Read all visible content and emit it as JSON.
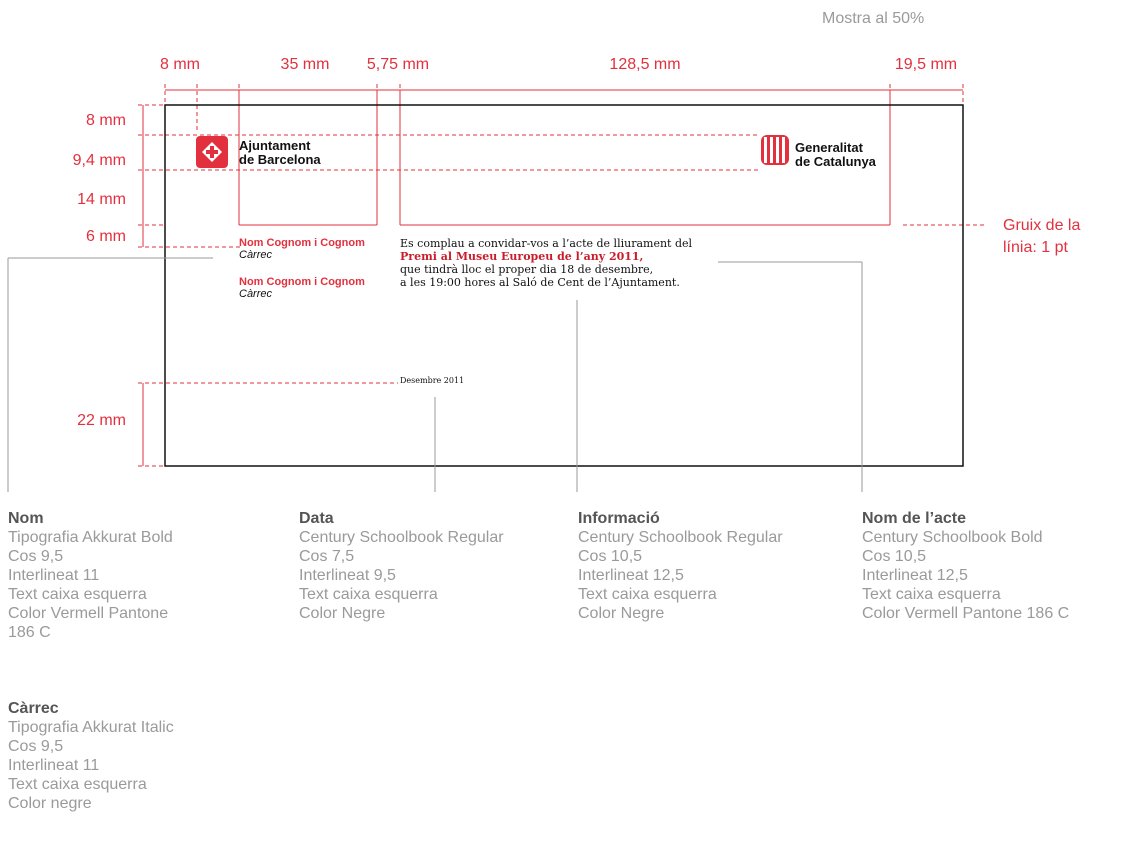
{
  "header": {
    "sample_scale": "Mostra al 50%"
  },
  "horizontal_measures": [
    "8 mm",
    "35 mm",
    "5,75 mm",
    "128,5 mm",
    "19,5 mm"
  ],
  "vertical_measures": [
    "8 mm",
    "9,4 mm",
    "14 mm",
    "6 mm",
    "22 mm"
  ],
  "line_note": {
    "line1": "Gruix de la",
    "line2": "línia: 1 pt"
  },
  "card": {
    "logo_left": {
      "line1": "Ajuntament",
      "line2": "de Barcelona"
    },
    "logo_right": {
      "line1": "Generalitat",
      "line2": "de Catalunya"
    },
    "signers": [
      {
        "name": "Nom Cognom i Cognom",
        "role": "Càrrec"
      },
      {
        "name": "Nom Cognom i Cognom",
        "role": "Càrrec"
      }
    ],
    "info_lines": [
      "Es complau a convidar-vos a l’acte de lliurament del",
      "Premi al Museu Europeu de l’any 2011,",
      "que tindrà lloc el proper dia 18 de desembre,",
      "a les 19:00 hores al Saló de Cent de l’Ajuntament."
    ],
    "date": "Desembre 2011"
  },
  "specs": {
    "nom": {
      "title": "Nom",
      "lines": [
        "Tipografia Akkurat Bold",
        "Cos 9,5",
        "Interlineat 11",
        "Text caixa esquerra",
        "Color Vermell Pantone",
        "186 C"
      ]
    },
    "carrec": {
      "title": "Càrrec",
      "lines": [
        "Tipografia Akkurat Italic",
        "Cos 9,5",
        "Interlineat 11",
        "Text caixa esquerra",
        "Color negre"
      ]
    },
    "data": {
      "title": "Data",
      "lines": [
        "Century Schoolbook Regular",
        "Cos 7,5",
        "Interlineat 9,5",
        "Text caixa esquerra",
        "Color Negre"
      ]
    },
    "informacio": {
      "title": "Informació",
      "lines": [
        "Century Schoolbook Regular",
        "Cos 10,5",
        "Interlineat 12,5",
        "Text caixa esquerra",
        "Color Negre"
      ]
    },
    "nom_acte": {
      "title": "Nom de l’acte",
      "lines": [
        "Century Schoolbook Bold",
        "Cos 10,5",
        "Interlineat 12,5",
        "Text caixa esquerra",
        "Color Vermell Pantone 186 C"
      ]
    }
  },
  "colors": {
    "accent_red": "#e3303e",
    "text_black": "#111111",
    "spec_gray": "#9a9a9a"
  }
}
